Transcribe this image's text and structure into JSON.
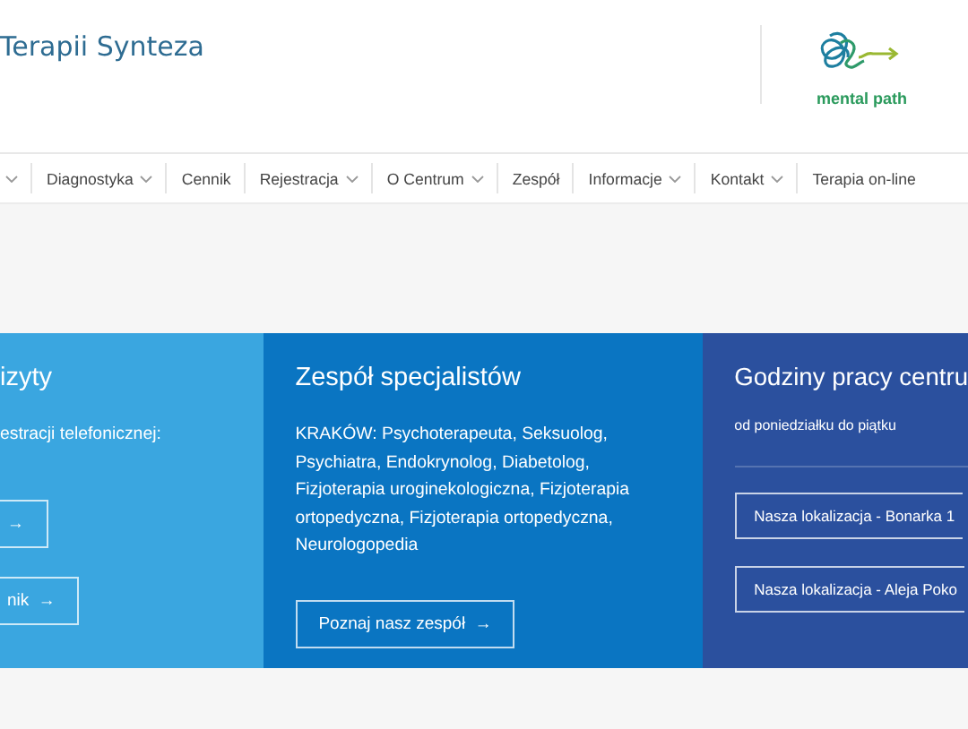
{
  "header": {
    "title": "Terapii Synteza",
    "logo_text": "mental path"
  },
  "nav": [
    {
      "dropdown": true
    },
    {
      "label": "Diagnostyka",
      "dropdown": true
    },
    {
      "label": "Cennik",
      "dropdown": false
    },
    {
      "label": "Rejestracja",
      "dropdown": true
    },
    {
      "label": "O Centrum",
      "dropdown": true
    },
    {
      "label": "Zespół",
      "dropdown": false
    },
    {
      "label": "Informacje",
      "dropdown": true
    },
    {
      "label": "Kontakt",
      "dropdown": true
    },
    {
      "label": "Terapia on-line",
      "dropdown": false
    }
  ],
  "panels": [
    {
      "title": "izyty",
      "text": "estracji telefonicznej:",
      "color": "#3aa6e0",
      "buttons": [
        {
          "arrow": "→"
        },
        {
          "label": "nik",
          "arrow": "→"
        }
      ]
    },
    {
      "title": "Zespół specjalistów",
      "text": "KRAKÓW: Psychoterapeuta, Seksuolog, Psychiatra, Endokrynolog, Diabetolog, Fizjoterapia uroginekologiczna, Fizjoterapia ortopedyczna, Fizjoterapia ortopedyczna, Neurologopedia",
      "color": "#0a75c2",
      "buttons": [
        {
          "label": "Poznaj nasz zespół",
          "arrow": "→"
        }
      ]
    },
    {
      "title": "Godziny pracy centru",
      "text": "od poniedziałku do piątku",
      "color": "#2b509e",
      "buttons": [
        {
          "label": "Nasza lokalizacja - Bonarka 1"
        },
        {
          "label": "Nasza lokalizacja - Aleja Poko"
        }
      ]
    }
  ]
}
